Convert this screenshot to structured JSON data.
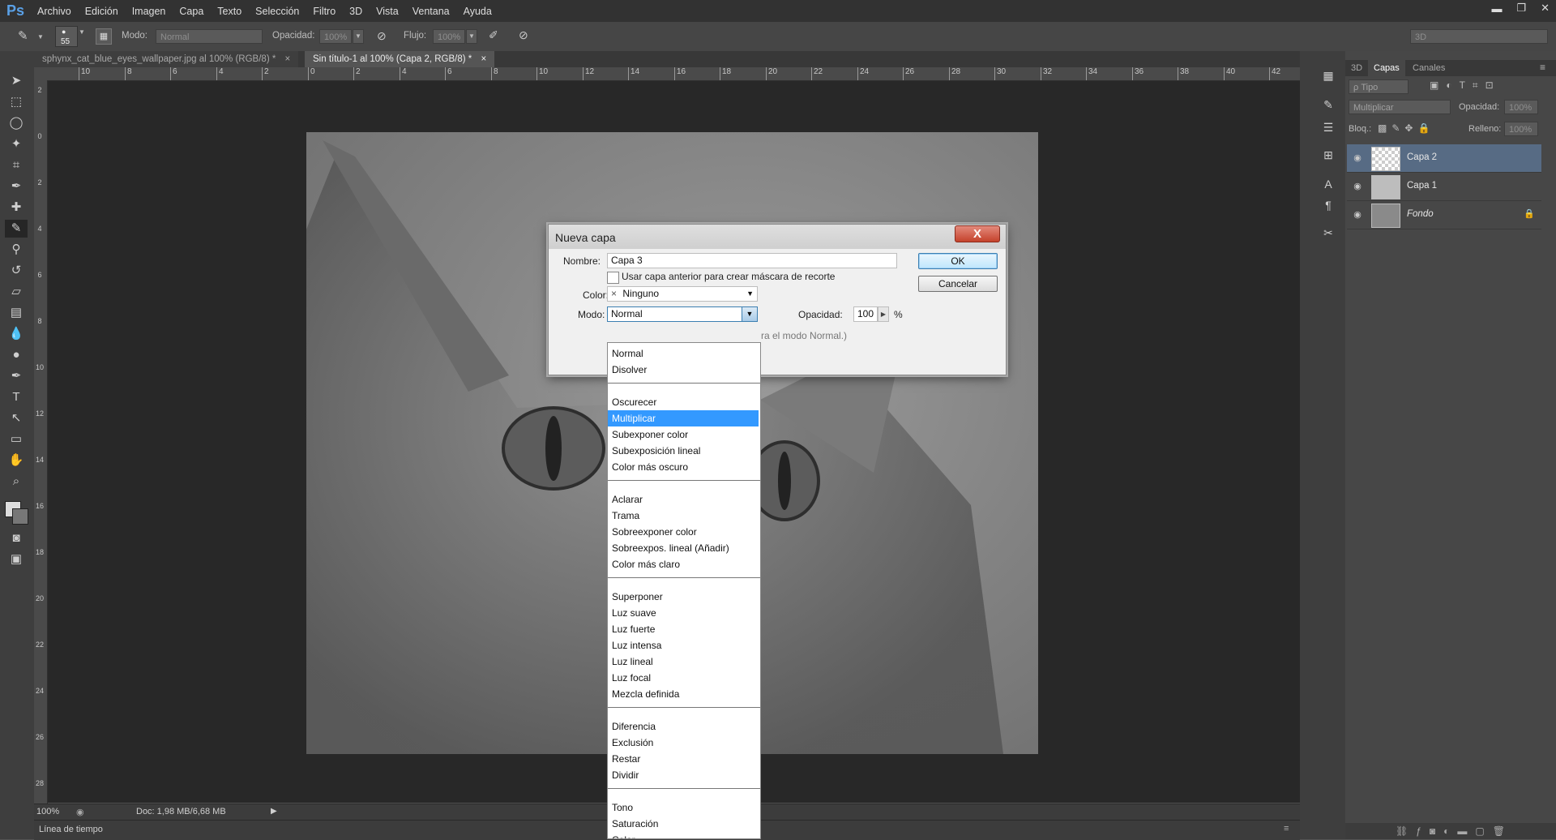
{
  "app": {
    "logo": "Ps"
  },
  "menu": [
    "Archivo",
    "Edición",
    "Imagen",
    "Capa",
    "Texto",
    "Selección",
    "Filtro",
    "3D",
    "Vista",
    "Ventana",
    "Ayuda"
  ],
  "options_bar": {
    "brush_size": "55",
    "mode_label": "Modo:",
    "mode_value": "Normal",
    "opacity_label": "Opacidad:",
    "opacity_value": "100%",
    "flow_label": "Flujo:",
    "flow_value": "100%",
    "workspace_value": "3D"
  },
  "tabs": [
    {
      "label": "sphynx_cat_blue_eyes_wallpaper.jpg al 100% (RGB/8) *",
      "close": "×"
    },
    {
      "label": "Sin título-1 al 100% (Capa 2, RGB/8) *",
      "close": "×"
    }
  ],
  "ruler_top": [
    "10",
    "8",
    "6",
    "4",
    "2",
    "0",
    "2",
    "4",
    "6",
    "8",
    "10",
    "12",
    "14",
    "16",
    "18",
    "20",
    "22",
    "24",
    "26",
    "28",
    "30",
    "32",
    "34",
    "36",
    "38",
    "40",
    "42"
  ],
  "ruler_left": [
    "2",
    "0",
    "2",
    "4",
    "6",
    "8",
    "10",
    "12",
    "14",
    "16",
    "18",
    "20",
    "22",
    "24",
    "26",
    "28"
  ],
  "status": {
    "zoom": "100%",
    "doc": "Doc: 1,98 MB/6,68 MB"
  },
  "timeline_label": "Línea de tiempo",
  "layers_panel": {
    "tabs": [
      "3D",
      "Capas",
      "Canales"
    ],
    "filter_label": "ρ Tipo",
    "blend_mode": "Multiplicar",
    "opacity_label": "Opacidad:",
    "opacity_value": "100%",
    "lock_label": "Bloq.:",
    "fill_label": "Relleno:",
    "fill_value": "100%",
    "layers": [
      "Capa 2",
      "Capa 1",
      "Fondo"
    ]
  },
  "dialog": {
    "title": "Nueva capa",
    "close": "X",
    "name_label": "Nombre:",
    "name_value": "Capa 3",
    "clip_label": "Usar capa anterior para crear máscara de recorte",
    "color_label": "Color:",
    "color_x": "×",
    "color_value": "Ninguno",
    "mode_label": "Modo:",
    "mode_value": "Normal",
    "opacity_label": "Opacidad:",
    "opacity_value": "100",
    "percent": "%",
    "note": "ra el modo Normal.)",
    "ok": "OK",
    "cancel": "Cancelar"
  },
  "mode_options": [
    {
      "group": [
        "Normal",
        "Disolver"
      ]
    },
    {
      "group": [
        "Oscurecer",
        "Multiplicar",
        "Subexponer color",
        "Subexposición lineal",
        "Color más oscuro"
      ]
    },
    {
      "group": [
        "Aclarar",
        "Trama",
        "Sobreexponer color",
        "Sobreexpos. lineal (Añadir)",
        "Color más claro"
      ]
    },
    {
      "group": [
        "Superponer",
        "Luz suave",
        "Luz fuerte",
        "Luz intensa",
        "Luz lineal",
        "Luz focal",
        "Mezcla definida"
      ]
    },
    {
      "group": [
        "Diferencia",
        "Exclusión",
        "Restar",
        "Dividir"
      ]
    },
    {
      "group": [
        "Tono",
        "Saturación",
        "Color"
      ]
    }
  ],
  "highlight_option": "Multiplicar",
  "colors": {
    "highlight": "#3399ff",
    "accent": "#5aa0e6"
  }
}
